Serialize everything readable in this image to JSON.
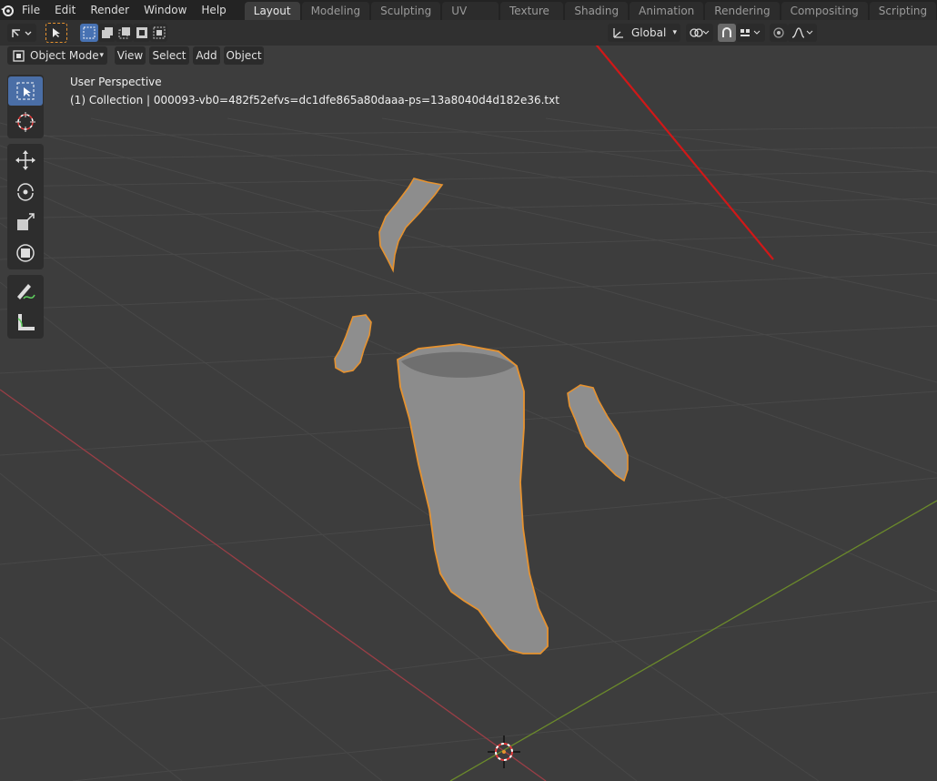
{
  "menu": {
    "items": [
      "File",
      "Edit",
      "Render",
      "Window",
      "Help"
    ]
  },
  "workspaces": {
    "tabs": [
      "Layout",
      "Modeling",
      "Sculpting",
      "UV Editing",
      "Texture Paint",
      "Shading",
      "Animation",
      "Rendering",
      "Compositing",
      "Scripting"
    ],
    "active": "Layout",
    "add": "+"
  },
  "header": {
    "orientation": "Global",
    "mode": "Object Mode",
    "view": "View",
    "select": "Select",
    "add": "Add",
    "object": "Object"
  },
  "viewport": {
    "perspective": "User Perspective",
    "collection": "(1) Collection | 000093-vb0=482f52efvs=dc1dfe865a80daaa-ps=13a8040d4d182e36.txt"
  },
  "colors": {
    "accent": "#4772b3",
    "outline": "#e6922f",
    "x_axis": "#9a3e46",
    "y_axis": "#6b8a2b",
    "arrow": "#d01818"
  }
}
